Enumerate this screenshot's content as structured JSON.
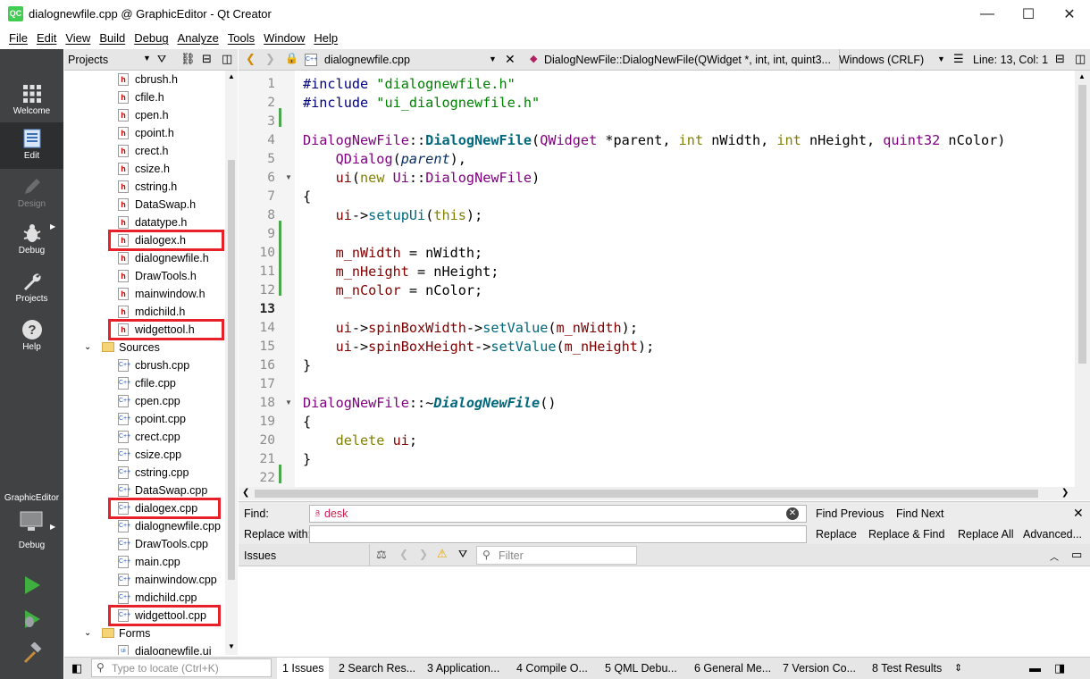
{
  "window": {
    "title": "dialognewfile.cpp @ GraphicEditor - Qt Creator",
    "app_icon": "QC",
    "minimize": "—",
    "maximize": "☐",
    "close": "✕"
  },
  "menu": [
    "File",
    "Edit",
    "View",
    "Build",
    "Debug",
    "Analyze",
    "Tools",
    "Window",
    "Help"
  ],
  "modes": [
    {
      "label": "Welcome",
      "icon": "grid-icon"
    },
    {
      "label": "Edit",
      "icon": "document-icon",
      "active": true
    },
    {
      "label": "Design",
      "icon": "pen-icon",
      "disabled": true
    },
    {
      "label": "Debug",
      "icon": "bug-icon"
    },
    {
      "label": "Projects",
      "icon": "wrench-icon"
    },
    {
      "label": "Help",
      "icon": "help-icon"
    }
  ],
  "kit": {
    "project": "GraphicEditor",
    "config": "Debug"
  },
  "projects_panel": {
    "title": "Projects"
  },
  "tree": [
    {
      "label": "cbrush.h",
      "type": "h"
    },
    {
      "label": "cfile.h",
      "type": "h"
    },
    {
      "label": "cpen.h",
      "type": "h"
    },
    {
      "label": "cpoint.h",
      "type": "h"
    },
    {
      "label": "crect.h",
      "type": "h"
    },
    {
      "label": "csize.h",
      "type": "h"
    },
    {
      "label": "cstring.h",
      "type": "h"
    },
    {
      "label": "DataSwap.h",
      "type": "h"
    },
    {
      "label": "datatype.h",
      "type": "h"
    },
    {
      "label": "dialogex.h",
      "type": "h",
      "highlight": true
    },
    {
      "label": "dialognewfile.h",
      "type": "h"
    },
    {
      "label": "DrawTools.h",
      "type": "h"
    },
    {
      "label": "mainwindow.h",
      "type": "h"
    },
    {
      "label": "mdichild.h",
      "type": "h"
    },
    {
      "label": "widgettool.h",
      "type": "h",
      "highlight": true
    },
    {
      "label": "Sources",
      "type": "folder"
    },
    {
      "label": "cbrush.cpp",
      "type": "cpp"
    },
    {
      "label": "cfile.cpp",
      "type": "cpp"
    },
    {
      "label": "cpen.cpp",
      "type": "cpp"
    },
    {
      "label": "cpoint.cpp",
      "type": "cpp"
    },
    {
      "label": "crect.cpp",
      "type": "cpp"
    },
    {
      "label": "csize.cpp",
      "type": "cpp"
    },
    {
      "label": "cstring.cpp",
      "type": "cpp"
    },
    {
      "label": "DataSwap.cpp",
      "type": "cpp"
    },
    {
      "label": "dialogex.cpp",
      "type": "cpp",
      "highlight": true
    },
    {
      "label": "dialognewfile.cpp",
      "type": "cpp"
    },
    {
      "label": "DrawTools.cpp",
      "type": "cpp"
    },
    {
      "label": "main.cpp",
      "type": "cpp"
    },
    {
      "label": "mainwindow.cpp",
      "type": "cpp"
    },
    {
      "label": "mdichild.cpp",
      "type": "cpp"
    },
    {
      "label": "widgettool.cpp",
      "type": "cpp",
      "highlight": true
    },
    {
      "label": "Forms",
      "type": "folder-forms"
    },
    {
      "label": "dialognewfile.ui",
      "type": "ui"
    }
  ],
  "editor_header": {
    "filename": "dialognewfile.cpp",
    "symbol": "DialogNewFile::DialogNewFile(QWidget *, int, int, quint3...",
    "encoding": "Windows (CRLF)",
    "position": "Line: 13, Col: 1"
  },
  "line_numbers": [
    "1",
    "2",
    "3",
    "4",
    "5",
    "6",
    "7",
    "8",
    "9",
    "10",
    "11",
    "12",
    "13",
    "14",
    "15",
    "16",
    "17",
    "18",
    "19",
    "20",
    "21",
    "22"
  ],
  "code": {
    "l1_pp": "#include ",
    "l1_str": "\"dialognewfile.h\"",
    "l2_pp": "#include ",
    "l2_str": "\"ui_dialognewfile.h\"",
    "l4_cls": "DialogNewFile",
    "l4_sep": "::",
    "l4_fn": "DialogNewFile",
    "l4_open": "(",
    "l4_t1": "QWidget",
    "l4_p1": " *parent, ",
    "l4_t2": "int",
    "l4_p2": " nWidth, ",
    "l4_t3": "int",
    "l4_p3": " nHeight, ",
    "l4_t4": "quint32",
    "l4_p4": " nColor)",
    "l5_ind": "    ",
    "l5_cls": "QDialog",
    "l5_o": "(",
    "l5_par": "parent",
    "l5_c": "),",
    "l6_ind": "    ",
    "l6_mem": "ui",
    "l6_o": "(",
    "l6_kw": "new ",
    "l6_cls": "Ui",
    "l6_sep": "::",
    "l6_cls2": "DialogNewFile",
    "l6_c": ")",
    "l7": "{",
    "l8_ind": "    ",
    "l8_mem": "ui",
    "l8_arr": "->",
    "l8_fn": "setupUi",
    "l8_o": "(",
    "l8_kw": "this",
    "l8_c": ");",
    "l10_ind": "    ",
    "l10_mem": "m_nWidth",
    "l10_rest": " = nWidth;",
    "l11_ind": "    ",
    "l11_mem": "m_nHeight",
    "l11_rest": " = nHeight;",
    "l12_ind": "    ",
    "l12_mem": "m_nColor",
    "l12_rest": " = nColor;",
    "l14_ind": "    ",
    "l14_mem": "ui",
    "l14_arr": "->",
    "l14_m2": "spinBoxWidth",
    "l14_arr2": "->",
    "l14_fn": "setValue",
    "l14_o": "(",
    "l14_m3": "m_nWidth",
    "l14_c": ");",
    "l15_ind": "    ",
    "l15_mem": "ui",
    "l15_arr": "->",
    "l15_m2": "spinBoxHeight",
    "l15_arr2": "->",
    "l15_fn": "setValue",
    "l15_o": "(",
    "l15_m3": "m_nHeight",
    "l15_c": ");",
    "l16": "}",
    "l18_cls": "DialogNewFile",
    "l18_sep": "::~",
    "l18_fn": "DialogNewFile",
    "l18_c": "()",
    "l19": "{",
    "l20_ind": "    ",
    "l20_kw": "delete ",
    "l20_mem": "ui",
    "l20_c": ";",
    "l21": "}"
  },
  "find": {
    "find_label": "Find:",
    "find_value": "desk",
    "replace_label": "Replace with:",
    "replace_value": "",
    "find_previous": "Find Previous",
    "find_next": "Find Next",
    "replace": "Replace",
    "replace_find": "Replace & Find",
    "replace_all": "Replace All",
    "advanced": "Advanced..."
  },
  "issues": {
    "title": "Issues",
    "filter_placeholder": "Filter"
  },
  "statusbar": {
    "locate_placeholder": "Type to locate (Ctrl+K)",
    "tabs": [
      "1  Issues",
      "2  Search Res...",
      "3  Application...",
      "4  Compile O...",
      "5  QML Debu...",
      "6  General Me...",
      "7  Version Co...",
      "8  Test Results"
    ]
  },
  "colors": {
    "highlight": "#e8202a",
    "modebar": "#404244",
    "run_green": "#3fb03f",
    "changed": "#4ea64e"
  }
}
